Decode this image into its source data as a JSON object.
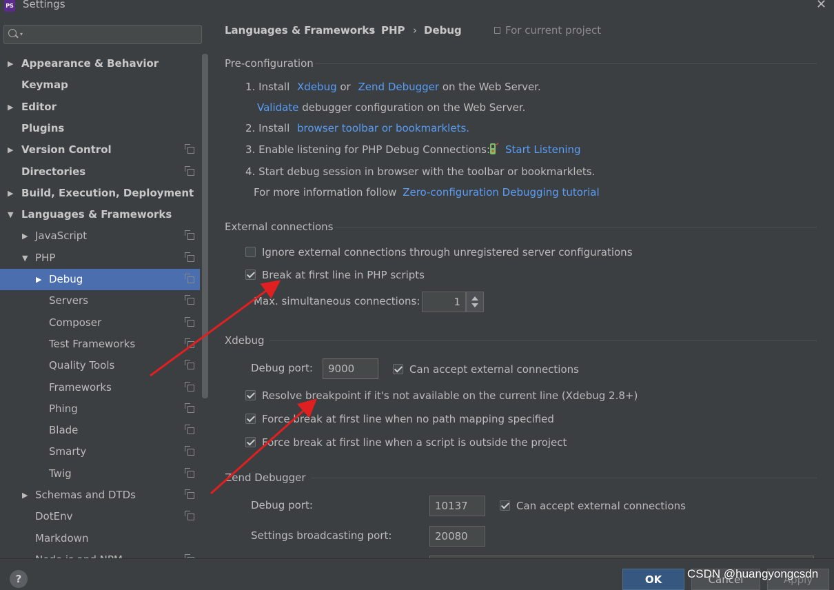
{
  "window": {
    "title": "Settings",
    "app_logo": "PS"
  },
  "search": {
    "placeholder": ""
  },
  "sidebar": {
    "items": [
      {
        "label": "Appearance & Behavior",
        "bold": true,
        "arrow": "▶",
        "has_copy": false
      },
      {
        "label": "Keymap",
        "bold": true,
        "arrow": "",
        "has_copy": false
      },
      {
        "label": "Editor",
        "bold": true,
        "arrow": "▶",
        "has_copy": false
      },
      {
        "label": "Plugins",
        "bold": true,
        "arrow": "",
        "has_copy": false
      },
      {
        "label": "Version Control",
        "bold": true,
        "arrow": "▶",
        "has_copy": true
      },
      {
        "label": "Directories",
        "bold": true,
        "arrow": "",
        "has_copy": true
      },
      {
        "label": "Build, Execution, Deployment",
        "bold": true,
        "arrow": "▶",
        "has_copy": false
      },
      {
        "label": "Languages & Frameworks",
        "bold": true,
        "arrow": "▼",
        "has_copy": false
      },
      {
        "label": "JavaScript",
        "bold": false,
        "arrow": "▶",
        "has_copy": true
      },
      {
        "label": "PHP",
        "bold": false,
        "arrow": "▼",
        "has_copy": true
      },
      {
        "label": "Debug",
        "bold": false,
        "arrow": "▶",
        "has_copy": true,
        "selected": true
      },
      {
        "label": "Servers",
        "bold": false,
        "arrow": "",
        "has_copy": true
      },
      {
        "label": "Composer",
        "bold": false,
        "arrow": "",
        "has_copy": true
      },
      {
        "label": "Test Frameworks",
        "bold": false,
        "arrow": "",
        "has_copy": true
      },
      {
        "label": "Quality Tools",
        "bold": false,
        "arrow": "",
        "has_copy": true
      },
      {
        "label": "Frameworks",
        "bold": false,
        "arrow": "",
        "has_copy": true
      },
      {
        "label": "Phing",
        "bold": false,
        "arrow": "",
        "has_copy": true
      },
      {
        "label": "Blade",
        "bold": false,
        "arrow": "",
        "has_copy": true
      },
      {
        "label": "Smarty",
        "bold": false,
        "arrow": "",
        "has_copy": true
      },
      {
        "label": "Twig",
        "bold": false,
        "arrow": "",
        "has_copy": true
      },
      {
        "label": "Schemas and DTDs",
        "bold": false,
        "arrow": "▶",
        "has_copy": true
      },
      {
        "label": "DotEnv",
        "bold": false,
        "arrow": "",
        "has_copy": true
      },
      {
        "label": "Markdown",
        "bold": false,
        "arrow": "",
        "has_copy": false
      },
      {
        "label": "Node.js and NPM",
        "bold": false,
        "arrow": "",
        "has_copy": true
      }
    ]
  },
  "breadcrumb": {
    "items": [
      "Languages & Frameworks",
      "PHP",
      "Debug"
    ],
    "separator": "›",
    "scope": "For current project"
  },
  "preconfig": {
    "title": "Pre-configuration",
    "s1_prefix": "1. Install",
    "s1_link1": "Xdebug",
    "s1_or": "or",
    "s1_link2": "Zend Debugger",
    "s1_suffix": "on the Web Server.",
    "validate_link": "Validate",
    "validate_text": "debugger configuration on the Web Server.",
    "s2_prefix": "2. Install",
    "s2_link": "browser toolbar or bookmarklets.",
    "s3_prefix": "3. Enable listening for PHP Debug Connections:",
    "s3_link": "Start Listening",
    "s4_text": "4. Start debug session in browser with the toolbar or bookmarklets.",
    "more_text": "For more information follow",
    "more_link": "Zero-configuration Debugging tutorial"
  },
  "external": {
    "title": "External connections",
    "ignore_label": "Ignore external connections through unregistered server configurations",
    "ignore_checked": false,
    "break_label": "Break at first line in PHP scripts",
    "break_checked": true,
    "max_label": "Max. simultaneous connections:",
    "max_value": "1"
  },
  "xdebug": {
    "title": "Xdebug",
    "port_label": "Debug port:",
    "port_value": "9000",
    "accept_label": "Can accept external connections",
    "accept_checked": true,
    "resolve_label": "Resolve breakpoint if it's not available on the current line (Xdebug 2.8+)",
    "force_nopath_label": "Force break at first line when no path mapping specified",
    "force_outside_label": "Force break at first line when a script is outside the project"
  },
  "zend": {
    "title": "Zend Debugger",
    "port_label": "Debug port:",
    "port_value": "10137",
    "accept_label": "Can accept external connections",
    "broadcast_label": "Settings broadcasting port:",
    "broadcast_value": "20080"
  },
  "buttons": {
    "help": "?",
    "ok": "OK",
    "cancel": "Cancel",
    "apply": "Apply"
  },
  "watermark": "CSDN @huangyongcsdn",
  "colors": {
    "accent": "#4b6eaf",
    "link": "#589df6",
    "annotation_arrow": "#e02020"
  }
}
